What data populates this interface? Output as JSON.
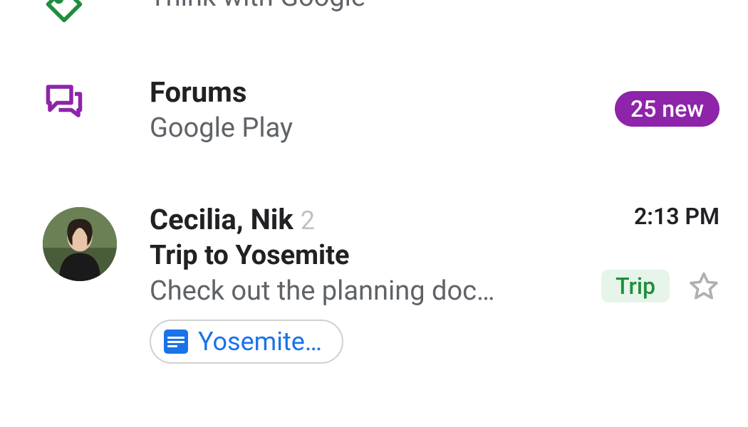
{
  "colors": {
    "accent_green": "#1e8e3e",
    "accent_purple": "#8e24aa",
    "link_blue": "#1a73e8",
    "tag_bg": "#e6f4ea",
    "tag_text": "#1e8e3e"
  },
  "items": [
    {
      "subtitle": "Think with Google"
    },
    {
      "title": "Forums",
      "subtitle": "Google Play",
      "badge": "25 new"
    },
    {
      "sender": "Cecilia, Nik",
      "count": "2",
      "time": "2:13 PM",
      "subject": "Trip to Yosemite",
      "preview": "Check out the planning doc…",
      "tag": "Trip",
      "attachment": "Yosemite…"
    }
  ]
}
